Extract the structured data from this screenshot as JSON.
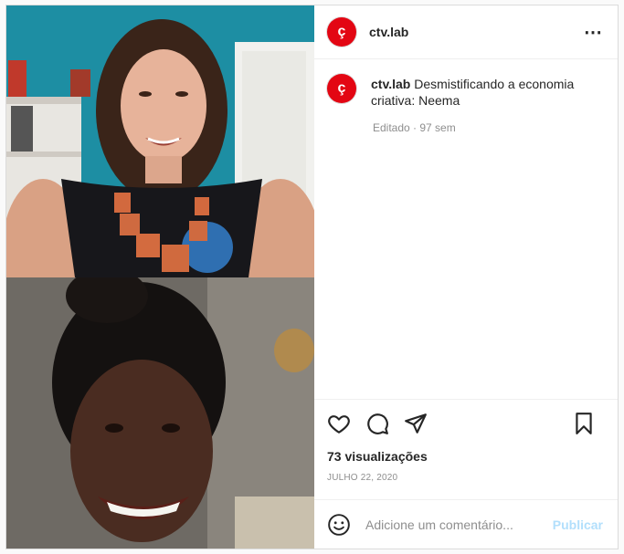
{
  "post": {
    "username": "ctv.lab",
    "avatar_glyph": "ç",
    "brand_color": "#e30613"
  },
  "caption": {
    "username": "ctv.lab",
    "text": "Desmistificando a economia criativa: Neema",
    "meta": "Editado · 97 sem"
  },
  "stats": {
    "views": "73 visualizações",
    "date": "JULHO 22, 2020"
  },
  "comment": {
    "placeholder": "Adicione um comentário...",
    "publish_label": "Publicar"
  },
  "icons": {
    "more": "more-options-icon",
    "like": "heart-icon",
    "comment": "comment-icon",
    "share": "paper-plane-icon",
    "save": "bookmark-icon",
    "emoji": "emoji-icon"
  }
}
